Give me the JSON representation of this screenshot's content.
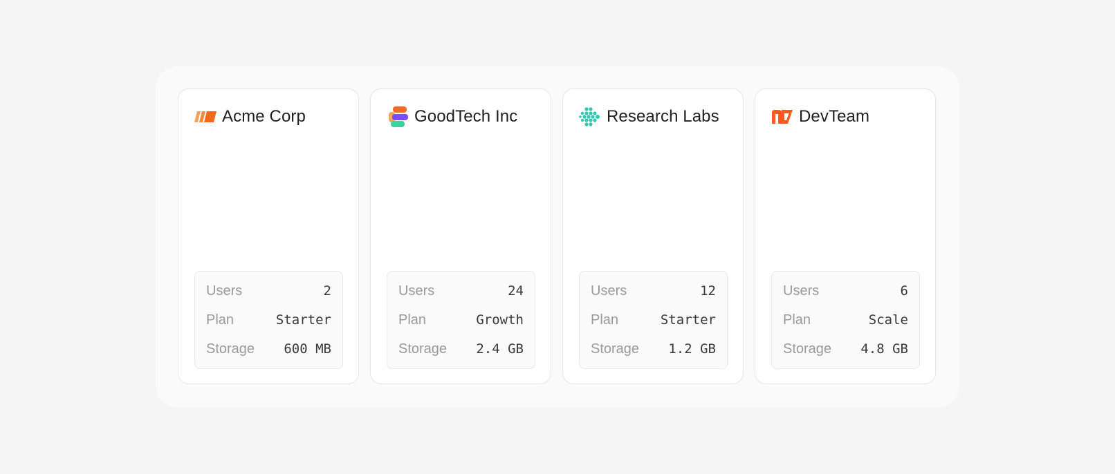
{
  "organizations": [
    {
      "name": "Acme Corp",
      "logo_icon": "acme-stripes-icon",
      "stats": [
        {
          "label": "Users",
          "value": "2"
        },
        {
          "label": "Plan",
          "value": "Starter"
        },
        {
          "label": "Storage",
          "value": "600 MB"
        }
      ]
    },
    {
      "name": "GoodTech Inc",
      "logo_icon": "goodtech-s-icon",
      "stats": [
        {
          "label": "Users",
          "value": "24"
        },
        {
          "label": "Plan",
          "value": "Growth"
        },
        {
          "label": "Storage",
          "value": "2.4 GB"
        }
      ]
    },
    {
      "name": "Research Labs",
      "logo_icon": "research-dots-icon",
      "stats": [
        {
          "label": "Users",
          "value": "12"
        },
        {
          "label": "Plan",
          "value": "Starter"
        },
        {
          "label": "Storage",
          "value": "1.2 GB"
        }
      ]
    },
    {
      "name": "DevTeam",
      "logo_icon": "devteam-mark-icon",
      "stats": [
        {
          "label": "Users",
          "value": "6"
        },
        {
          "label": "Plan",
          "value": "Scale"
        },
        {
          "label": "Storage",
          "value": "4.8 GB"
        }
      ]
    }
  ],
  "colors": {
    "acme_orange": "#f47a2a",
    "goodtech_orange": "#f56b2a",
    "goodtech_purple": "#7b4dff",
    "goodtech_green": "#3bd3a0",
    "research_teal": "#2fc7b0",
    "devteam_orange": "#ff5a1f"
  }
}
